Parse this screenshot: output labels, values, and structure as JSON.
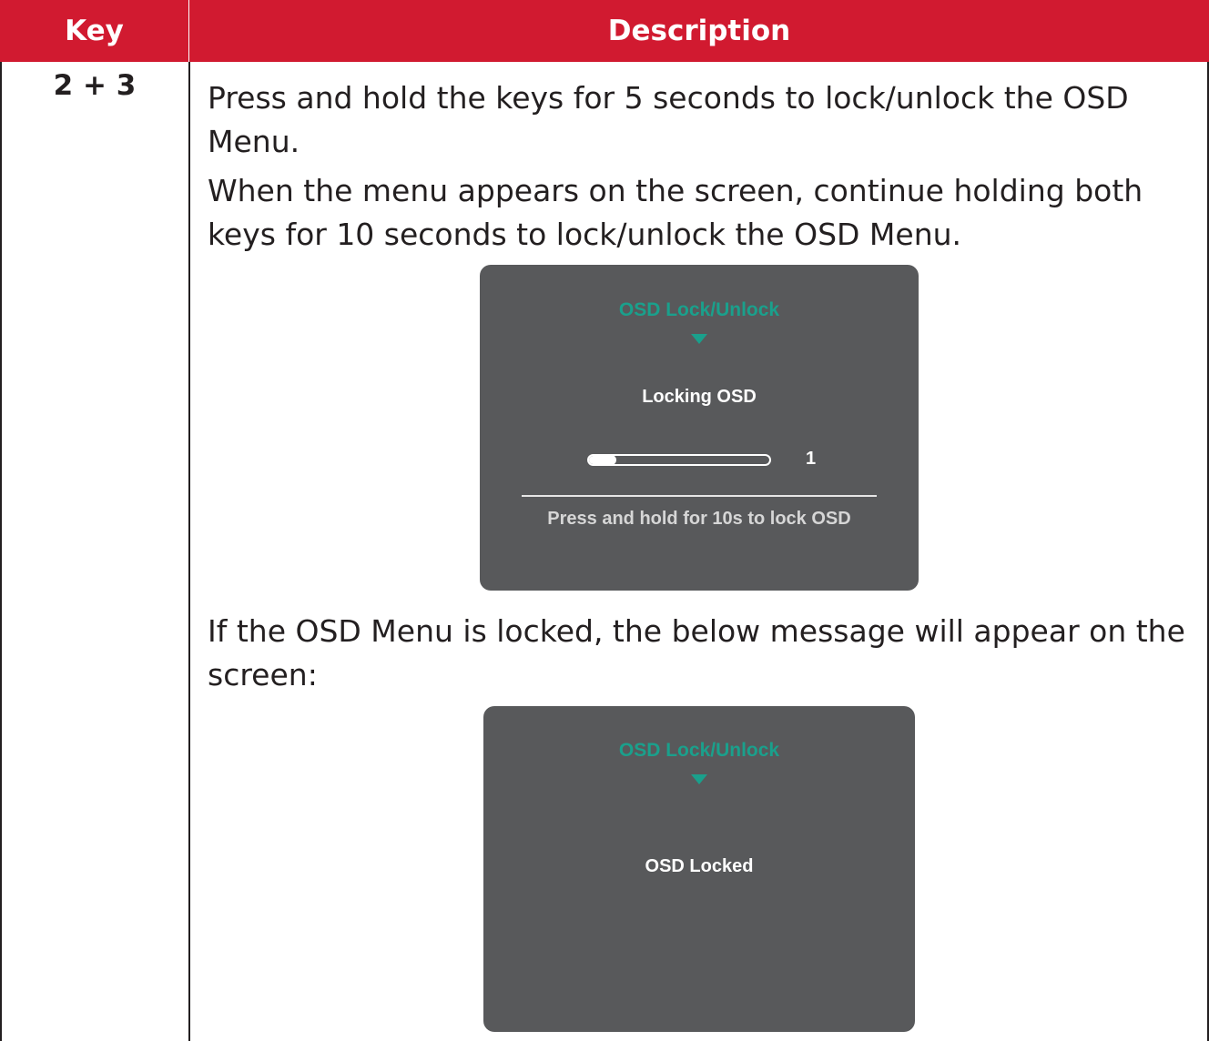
{
  "header": {
    "key_label": "Key",
    "description_label": "Description"
  },
  "row": {
    "key": "2 + 3",
    "paragraph_1": "Press and hold the keys for 5 seconds to lock/unlock the OSD Menu.",
    "paragraph_2": "When the menu appears on the screen, continue holding both keys for 10 seconds to lock/unlock the OSD Menu.",
    "paragraph_3": "If the OSD Menu is locked, the below message will appear on the screen:"
  },
  "osd_locking": {
    "title": "OSD Lock/Unlock",
    "message": "Locking OSD",
    "progress_fraction": 0.12,
    "counter": "1",
    "hint": "Press and hold for 10s to lock OSD"
  },
  "osd_locked": {
    "title": "OSD Lock/Unlock",
    "message": "OSD Locked"
  },
  "colors": {
    "header_bg": "#d11a30",
    "osd_bg": "#58595b",
    "osd_accent": "#1aa08c"
  }
}
